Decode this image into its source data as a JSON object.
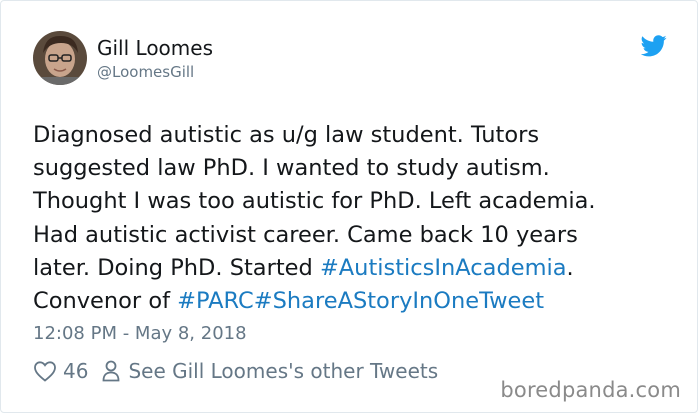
{
  "tweet": {
    "author": {
      "display_name": "Gill Loomes",
      "handle": "@LoomesGill",
      "avatar_icon": "user-avatar-photo"
    },
    "platform_icon": "twitter-bird-icon",
    "text_segments": [
      {
        "text": "Diagnosed autistic as u/g law student. Tutors\nsuggested law PhD. I wanted to study autism.\nThought I was too autistic for PhD. Left academia.\nHad autistic activist career. Came back 10 years\nlater. Doing PhD. Started ",
        "type": "text"
      },
      {
        "text": "#AutisticsInAcademia",
        "type": "hashtag"
      },
      {
        "text": ".\nConvenor of ",
        "type": "text"
      },
      {
        "text": "#PARC",
        "type": "hashtag"
      },
      {
        "text": "#ShareAStoryInOneTweet",
        "type": "hashtag"
      }
    ],
    "timestamp": "12:08 PM - May 8, 2018",
    "likes": "46",
    "other_tweets_label": "See Gill Loomes's other Tweets"
  },
  "watermark": "boredpanda.com",
  "colors": {
    "hashtag": "#1b7bc1",
    "twitter_blue": "#1da1f2",
    "secondary_text": "#657786"
  }
}
